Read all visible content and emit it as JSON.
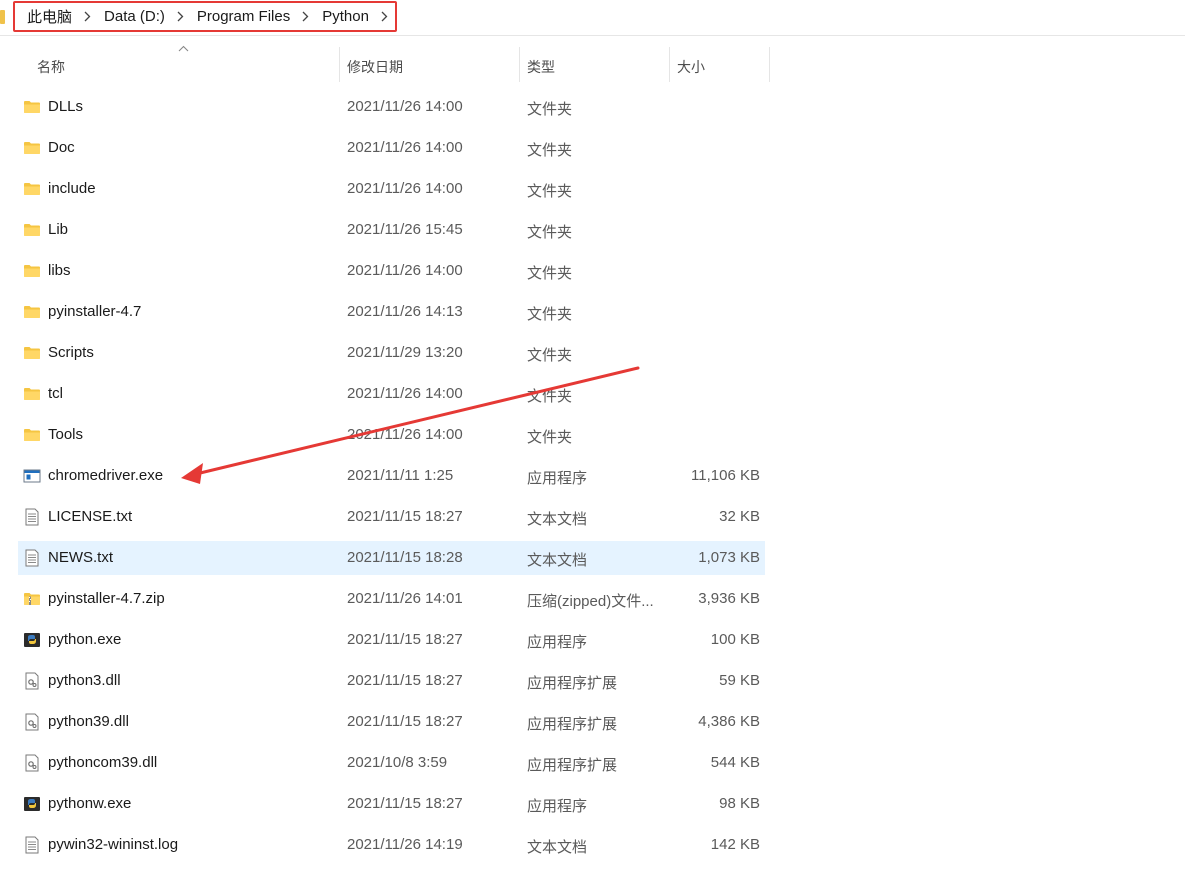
{
  "breadcrumb": {
    "items": [
      "此电脑",
      "Data (D:)",
      "Program Files",
      "Python"
    ]
  },
  "columns": {
    "name": "名称",
    "date": "修改日期",
    "type": "类型",
    "size": "大小"
  },
  "files": [
    {
      "name": "DLLs",
      "date": "2021/11/26 14:00",
      "type": "文件夹",
      "size": "",
      "icon": "folder-icon"
    },
    {
      "name": "Doc",
      "date": "2021/11/26 14:00",
      "type": "文件夹",
      "size": "",
      "icon": "folder-icon"
    },
    {
      "name": "include",
      "date": "2021/11/26 14:00",
      "type": "文件夹",
      "size": "",
      "icon": "folder-icon"
    },
    {
      "name": "Lib",
      "date": "2021/11/26 15:45",
      "type": "文件夹",
      "size": "",
      "icon": "folder-icon"
    },
    {
      "name": "libs",
      "date": "2021/11/26 14:00",
      "type": "文件夹",
      "size": "",
      "icon": "folder-icon"
    },
    {
      "name": "pyinstaller-4.7",
      "date": "2021/11/26 14:13",
      "type": "文件夹",
      "size": "",
      "icon": "folder-icon"
    },
    {
      "name": "Scripts",
      "date": "2021/11/29 13:20",
      "type": "文件夹",
      "size": "",
      "icon": "folder-icon"
    },
    {
      "name": "tcl",
      "date": "2021/11/26 14:00",
      "type": "文件夹",
      "size": "",
      "icon": "folder-icon"
    },
    {
      "name": "Tools",
      "date": "2021/11/26 14:00",
      "type": "文件夹",
      "size": "",
      "icon": "folder-icon"
    },
    {
      "name": "chromedriver.exe",
      "date": "2021/11/11 1:25",
      "type": "应用程序",
      "size": "11,106 KB",
      "icon": "exe-icon"
    },
    {
      "name": "LICENSE.txt",
      "date": "2021/11/15 18:27",
      "type": "文本文档",
      "size": "32 KB",
      "icon": "text-file-icon"
    },
    {
      "name": "NEWS.txt",
      "date": "2021/11/15 18:28",
      "type": "文本文档",
      "size": "1,073 KB",
      "icon": "text-file-icon",
      "selected": true
    },
    {
      "name": "pyinstaller-4.7.zip",
      "date": "2021/11/26 14:01",
      "type": "压缩(zipped)文件...",
      "size": "3,936 KB",
      "icon": "zip-folder-icon"
    },
    {
      "name": "python.exe",
      "date": "2021/11/15 18:27",
      "type": "应用程序",
      "size": "100 KB",
      "icon": "python-icon"
    },
    {
      "name": "python3.dll",
      "date": "2021/11/15 18:27",
      "type": "应用程序扩展",
      "size": "59 KB",
      "icon": "dll-icon"
    },
    {
      "name": "python39.dll",
      "date": "2021/11/15 18:27",
      "type": "应用程序扩展",
      "size": "4,386 KB",
      "icon": "dll-icon"
    },
    {
      "name": "pythoncom39.dll",
      "date": "2021/10/8 3:59",
      "type": "应用程序扩展",
      "size": "544 KB",
      "icon": "dll-icon"
    },
    {
      "name": "pythonw.exe",
      "date": "2021/11/15 18:27",
      "type": "应用程序",
      "size": "98 KB",
      "icon": "python-icon"
    },
    {
      "name": "pywin32-wininst.log",
      "date": "2021/11/26 14:19",
      "type": "文本文档",
      "size": "142 KB",
      "icon": "text-file-icon"
    }
  ],
  "colors": {
    "highlight_box": "#e53935",
    "annotation_arrow": "#e53935",
    "selected_row": "#e5f3ff",
    "folder": "#f5c542"
  }
}
